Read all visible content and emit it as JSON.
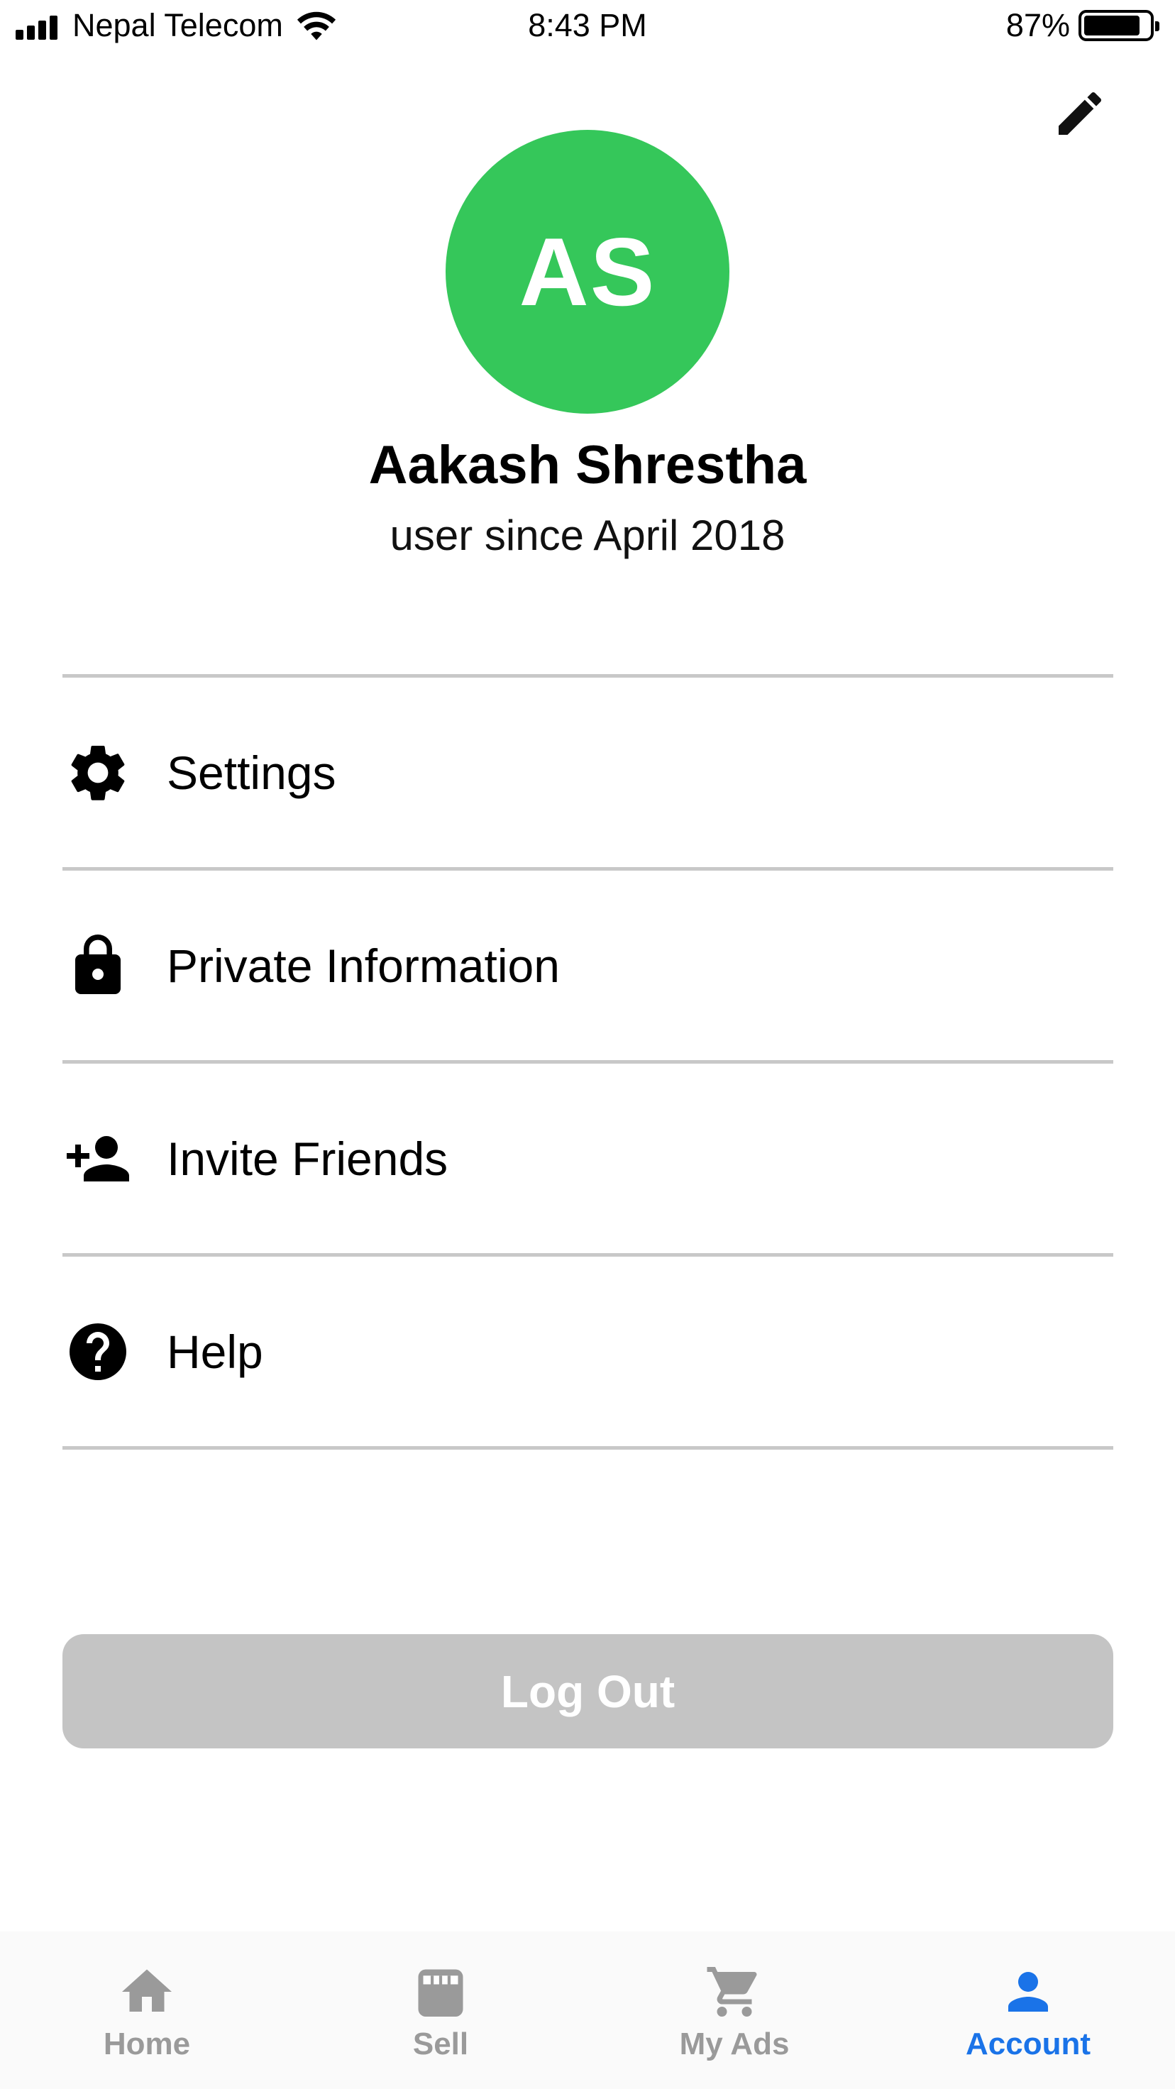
{
  "status_bar": {
    "carrier": "Nepal Telecom",
    "time": "8:43 PM",
    "battery": "87%",
    "battery_level": 0.87
  },
  "header": {
    "edit_icon": "pencil-icon"
  },
  "profile": {
    "initials": "AS",
    "avatar_color": "#35c75a",
    "name": "Aakash Shrestha",
    "since": "user since April 2018"
  },
  "menu": {
    "items": [
      {
        "label": "Settings",
        "icon": "gear-icon"
      },
      {
        "label": "Private Information",
        "icon": "lock-icon"
      },
      {
        "label": "Invite Friends",
        "icon": "add-person-icon"
      },
      {
        "label": "Help",
        "icon": "help-circle-icon"
      }
    ]
  },
  "logout": {
    "label": "Log Out"
  },
  "tab_bar": {
    "active_color": "#1a73e8",
    "inactive_color": "#9a9a9a",
    "tabs": [
      {
        "label": "Home",
        "icon": "home-icon",
        "active": false
      },
      {
        "label": "Sell",
        "icon": "store-icon",
        "active": false
      },
      {
        "label": "My Ads",
        "icon": "cart-icon",
        "active": false
      },
      {
        "label": "Account",
        "icon": "person-icon",
        "active": true
      }
    ]
  }
}
